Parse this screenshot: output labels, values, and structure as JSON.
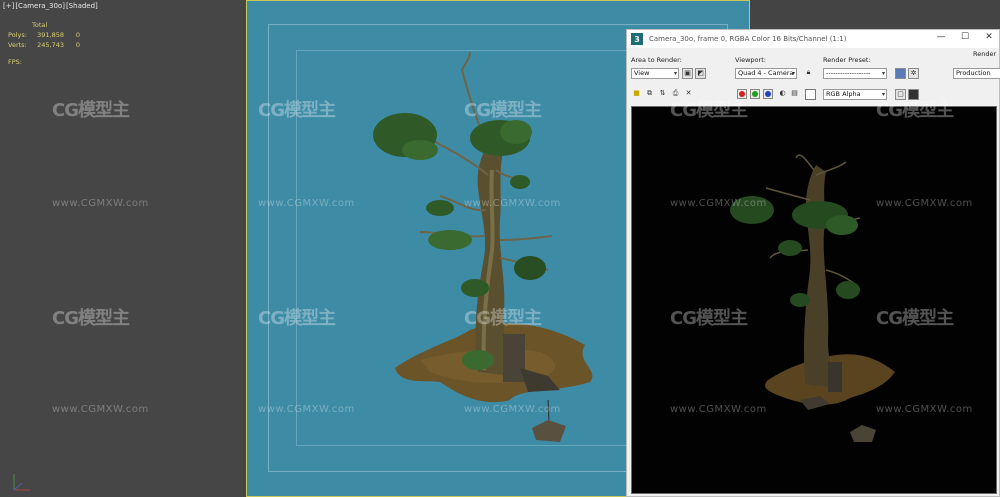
{
  "viewport": {
    "label": [
      "[+]",
      "[Camera_30o]",
      "[Shaded]"
    ],
    "stats_header": "Total",
    "stats": [
      {
        "key": "Polys:",
        "v1": "391,858",
        "v2": "0"
      },
      {
        "key": "Verts:",
        "v1": "245,743",
        "v2": "0"
      }
    ],
    "fps_label": "FPS:"
  },
  "render_window": {
    "logo": "3",
    "title": "Camera_30o, frame 0, RGBA Color 16 Bits/Channel (1:1)",
    "controls": {
      "minimize": "—",
      "maximize": "☐",
      "close": "✕"
    },
    "area_to_render_label": "Area to Render:",
    "area_to_render_value": "View",
    "viewport_label": "Viewport:",
    "viewport_value": "Quad 4 - Camera",
    "render_preset_label": "Render Preset:",
    "render_preset_value": "-------------------",
    "render_button_label": "Render",
    "render_mode_value": "Production",
    "channel_value": "RGB Alpha"
  },
  "watermark": {
    "logo_text": "CG模型主",
    "url_text": "www.CGMXW.com"
  },
  "colors": {
    "viewport_bg": "#464646",
    "camera_bg": "#3e8ba6",
    "frame_border": "#c8c85a",
    "stats_text": "#d8d070",
    "render_bg": "#020202"
  }
}
